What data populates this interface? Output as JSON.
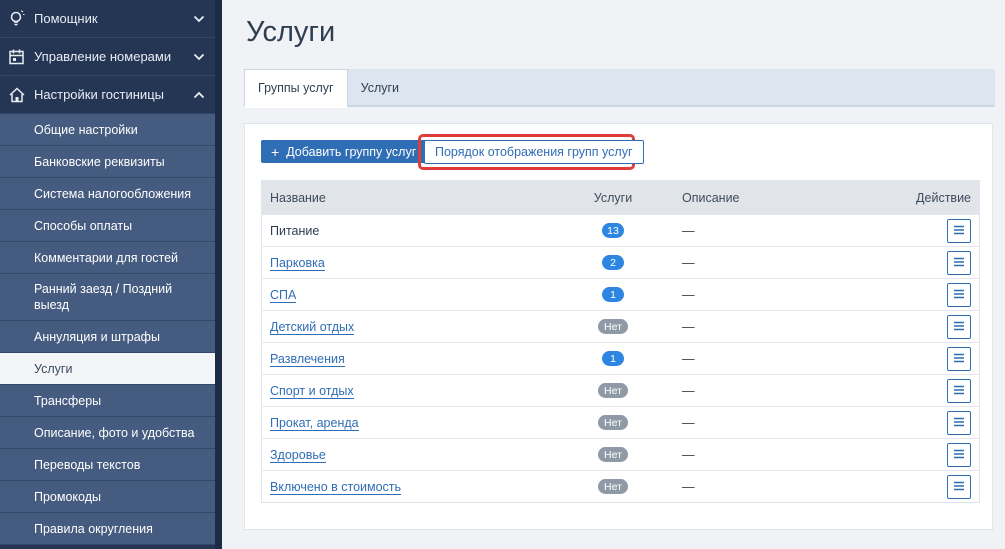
{
  "sidebar": {
    "top_items": [
      {
        "label": "Помощник",
        "icon": "lightbulb-icon",
        "chevron": "chevron-down-icon"
      },
      {
        "label": "Управление номерами",
        "icon": "calendar-icon",
        "chevron": "chevron-down-icon"
      },
      {
        "label": "Настройки гостиницы",
        "icon": "home-icon",
        "chevron": "chevron-up-icon"
      }
    ],
    "sub_items": [
      {
        "label": "Общие настройки"
      },
      {
        "label": "Банковские реквизиты"
      },
      {
        "label": "Система налогообложения"
      },
      {
        "label": "Способы оплаты"
      },
      {
        "label": "Комментарии для гостей"
      },
      {
        "label": "Ранний заезд / Поздний выезд"
      },
      {
        "label": "Аннуляция и штрафы"
      },
      {
        "label": "Услуги",
        "active": true
      },
      {
        "label": "Трансферы"
      },
      {
        "label": "Описание, фото и удобства"
      },
      {
        "label": "Переводы текстов"
      },
      {
        "label": "Промокоды"
      },
      {
        "label": "Правила округления"
      }
    ]
  },
  "page": {
    "title": "Услуги",
    "tabs": [
      {
        "label": "Группы услуг",
        "active": true
      },
      {
        "label": "Услуги",
        "active": false
      }
    ],
    "buttons": {
      "add_group": "Добавить группу услуг",
      "display_order": "Порядок отображения групп услуг"
    }
  },
  "table": {
    "headers": {
      "name": "Название",
      "services": "Услуги",
      "description": "Описание",
      "action": "Действие"
    },
    "rows": [
      {
        "name": "Питание",
        "link": false,
        "count": "13",
        "description": "—"
      },
      {
        "name": "Парковка",
        "link": true,
        "count": "2",
        "description": "—"
      },
      {
        "name": "СПА",
        "link": true,
        "count": "1",
        "description": "—"
      },
      {
        "name": "Детский отдых",
        "link": true,
        "count": "Нет",
        "description": "—"
      },
      {
        "name": "Развлечения",
        "link": true,
        "count": "1",
        "description": "—"
      },
      {
        "name": "Спорт и отдых",
        "link": true,
        "count": "Нет",
        "description": "—"
      },
      {
        "name": "Прокат, аренда",
        "link": true,
        "count": "Нет",
        "description": "—"
      },
      {
        "name": "Здоровье",
        "link": true,
        "count": "Нет",
        "description": "—"
      },
      {
        "name": "Включено в стоимость",
        "link": true,
        "count": "Нет",
        "description": "—"
      }
    ]
  },
  "colors": {
    "sidebar_bg": "#253654",
    "submenu_bg": "#455b7f",
    "accent": "#2f6db5",
    "badge_blue": "#2f86e0",
    "badge_gray": "#8f9aa6",
    "highlight_red": "#e03c3c"
  }
}
